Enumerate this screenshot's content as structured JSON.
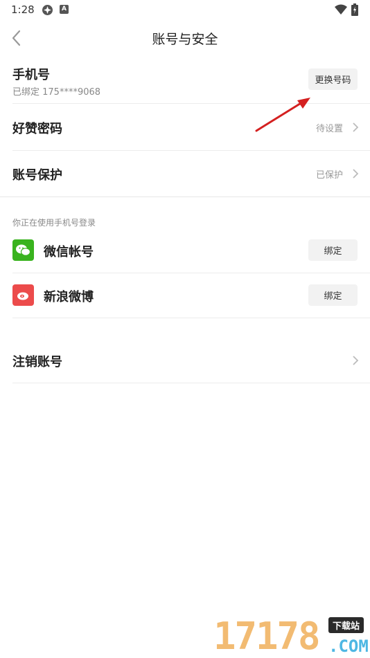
{
  "status_bar": {
    "time": "1:28",
    "icon_badge": "A"
  },
  "header": {
    "title": "账号与安全"
  },
  "phone": {
    "title": "手机号",
    "subtitle": "已绑定  175****9068",
    "change_button": "更换号码"
  },
  "password": {
    "title": "好赞密码",
    "status": "待设置"
  },
  "protection": {
    "title": "账号保护",
    "status": "已保护"
  },
  "login_section": {
    "label": "你正在使用手机号登录"
  },
  "wechat": {
    "label": "微信帐号",
    "button": "绑定",
    "color": "#39b31e"
  },
  "weibo": {
    "label": "新浪微博",
    "button": "绑定",
    "color": "#ec4b4b"
  },
  "cancel_account": {
    "title": "注销账号"
  },
  "watermark": {
    "digits": "17178",
    "tag": "下载站",
    "domain": ".COM"
  },
  "colors": {
    "arrow": "#d42020",
    "chevron": "#bbbbbb"
  }
}
